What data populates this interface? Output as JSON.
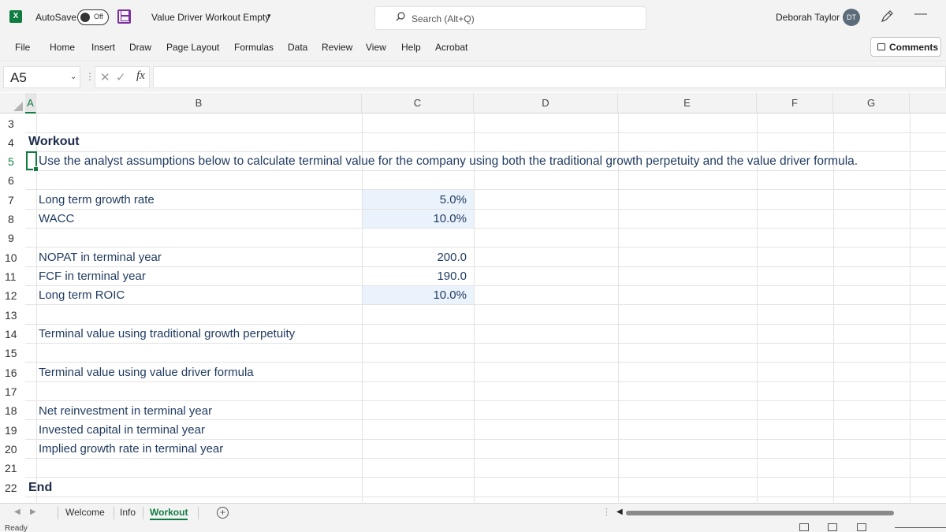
{
  "titlebar": {
    "app_icon_label": "X",
    "autosave_label": "AutoSave",
    "autosave_state": "Off",
    "document_title": "Value Driver Workout Empty",
    "search_placeholder": "Search (Alt+Q)",
    "user_name": "Deborah Taylor",
    "user_initials": "DT",
    "minimize_glyph": "—"
  },
  "ribbon": {
    "tabs": [
      "File",
      "Home",
      "Insert",
      "Draw",
      "Page Layout",
      "Formulas",
      "Data",
      "Review",
      "View",
      "Help",
      "Acrobat"
    ],
    "comments_label": "Comments"
  },
  "formula_bar": {
    "name_box": "A5",
    "fx_label": "fx",
    "formula_value": ""
  },
  "columns": [
    "A",
    "B",
    "C",
    "D",
    "E",
    "F",
    "G"
  ],
  "selected_column": "A",
  "rows": [
    "3",
    "4",
    "5",
    "6",
    "7",
    "8",
    "9",
    "10",
    "11",
    "12",
    "13",
    "14",
    "15",
    "16",
    "17",
    "18",
    "19",
    "20",
    "21",
    "22"
  ],
  "sheet": {
    "heading": "Workout",
    "instruction": "Use the analyst assumptions below to calculate terminal value for the company using both the traditional growth perpetuity and the value driver formula.",
    "end_label": "End",
    "labels": {
      "long_term_growth": "Long term growth rate",
      "wacc": "WACC",
      "nopat": "NOPAT in terminal year",
      "fcf": "FCF in terminal year",
      "roic": "Long term ROIC",
      "tv_growth": "Terminal value using traditional growth perpetuity",
      "tv_value_driver": "Terminal value using value driver formula",
      "net_reinvestment": "Net reinvestment in terminal year",
      "invested_capital": "Invested capital in terminal year",
      "implied_growth": "Implied growth rate in terminal year"
    },
    "values": {
      "long_term_growth": "5.0%",
      "wacc": "10.0%",
      "nopat": "200.0",
      "fcf": "190.0",
      "roic": "10.0%"
    }
  },
  "sheet_tabs": {
    "tabs": [
      "Welcome",
      "Info",
      "Workout"
    ],
    "active": "Workout",
    "add_glyph": "+"
  },
  "status": {
    "text": "Ready"
  },
  "colors": {
    "excel_green": "#107c41",
    "input_fill": "#eaf2fb",
    "text_blue": "#1f3a5f"
  }
}
